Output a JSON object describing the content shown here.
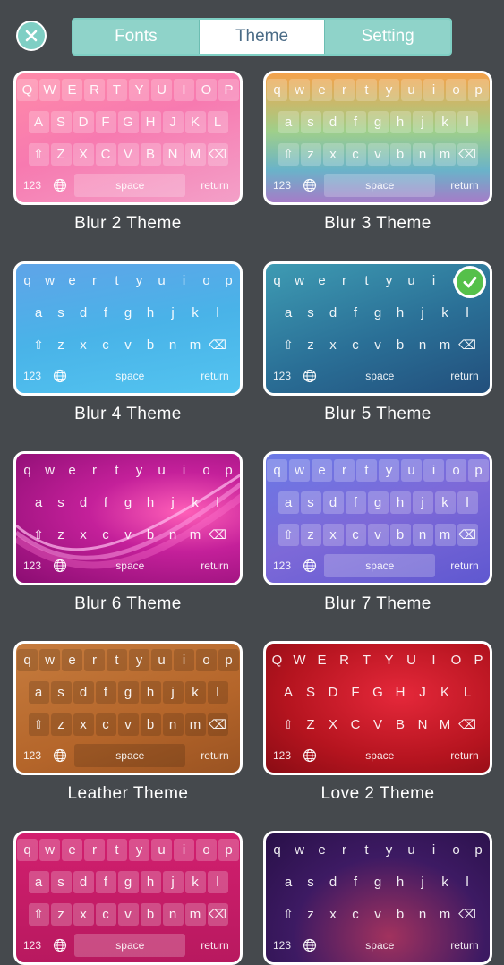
{
  "header": {
    "close_icon": "close-icon",
    "tabs": [
      {
        "label": "Fonts",
        "active": false
      },
      {
        "label": "Theme",
        "active": true
      },
      {
        "label": "Setting",
        "active": false
      }
    ],
    "accent": "#7fcfc4"
  },
  "keyboard_labels": {
    "upper": {
      "row1": [
        "Q",
        "W",
        "E",
        "R",
        "T",
        "Y",
        "U",
        "I",
        "O",
        "P"
      ],
      "row2": [
        "A",
        "S",
        "D",
        "F",
        "G",
        "H",
        "J",
        "K",
        "L"
      ],
      "row3": [
        "⇧",
        "Z",
        "X",
        "C",
        "V",
        "B",
        "N",
        "M",
        "⌫"
      ]
    },
    "lower": {
      "row1": [
        "q",
        "w",
        "e",
        "r",
        "t",
        "y",
        "u",
        "i",
        "o",
        "p"
      ],
      "row2": [
        "a",
        "s",
        "d",
        "f",
        "g",
        "h",
        "j",
        "k",
        "l"
      ],
      "row3": [
        "⇧",
        "z",
        "x",
        "c",
        "v",
        "b",
        "n",
        "m",
        "⌫"
      ]
    },
    "num_key": "123",
    "space_key": "space",
    "return_key": "return"
  },
  "themes": [
    {
      "name": "Blur 2 Theme",
      "case": "upper",
      "selected": false
    },
    {
      "name": "Blur 3 Theme",
      "case": "lower",
      "selected": false
    },
    {
      "name": "Blur 4 Theme",
      "case": "lower",
      "selected": false
    },
    {
      "name": "Blur 5 Theme",
      "case": "lower",
      "selected": true
    },
    {
      "name": "Blur 6 Theme",
      "case": "lower",
      "selected": false
    },
    {
      "name": "Blur 7 Theme",
      "case": "lower",
      "selected": false
    },
    {
      "name": "Leather Theme",
      "case": "lower",
      "selected": false
    },
    {
      "name": "Love 2 Theme",
      "case": "upper",
      "selected": false
    },
    {
      "name": "",
      "case": "lower",
      "selected": false
    },
    {
      "name": "",
      "case": "lower",
      "selected": false
    }
  ]
}
